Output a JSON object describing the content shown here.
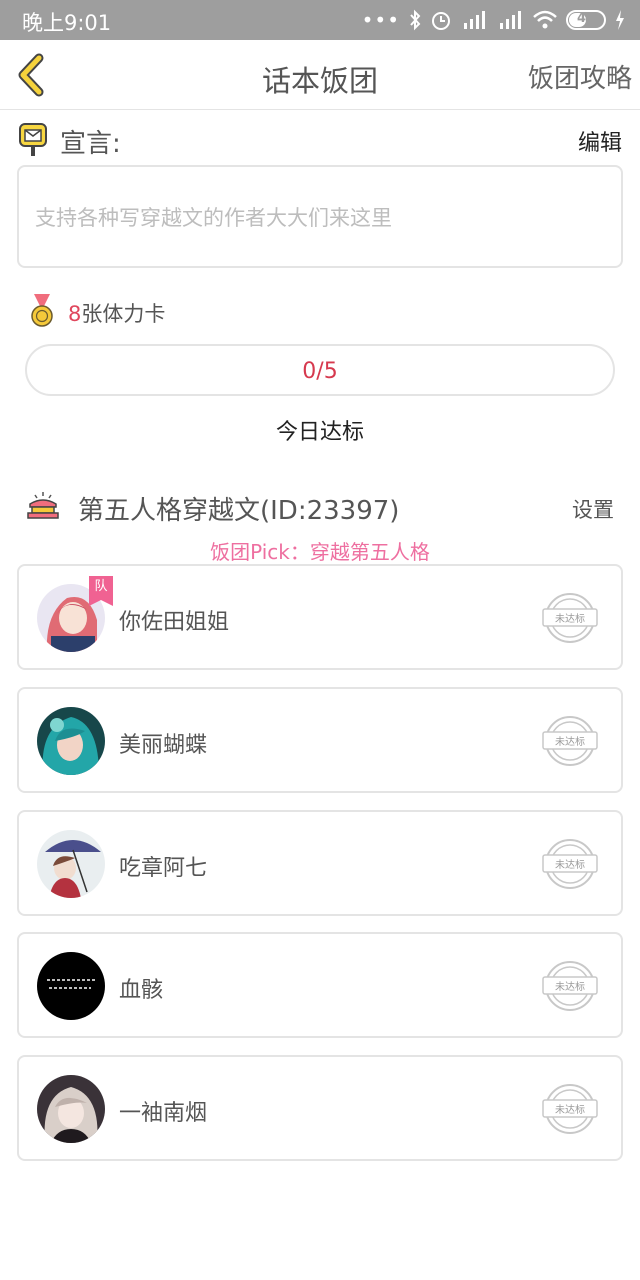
{
  "status_bar": {
    "time": "晚上9:01",
    "dots": "•••",
    "battery": "49"
  },
  "header": {
    "title": "话本饭团",
    "guide_label": "饭团攻略"
  },
  "declaration": {
    "label": "宣言:",
    "edit_label": "编辑",
    "text": "支持各种写穿越文的作者大大们来这里"
  },
  "stamina": {
    "count": "8",
    "unit": "张体力卡",
    "progress_text": "0/5",
    "progress_value": 0,
    "today_label": "今日达标"
  },
  "group": {
    "name": "第五人格穿越文(ID:23397)",
    "settings_label": "设置",
    "pick": "饭团Pick：穿越第五人格"
  },
  "members": [
    {
      "name": "你佐田姐姐",
      "badge": "队",
      "stamp": "未达标",
      "avatar": "avatar-anime-girl-pink-hair"
    },
    {
      "name": "美丽蝴蝶",
      "stamp": "未达标",
      "avatar": "avatar-teal-hair-girl"
    },
    {
      "name": "吃章阿七",
      "stamp": "未达标",
      "avatar": "avatar-girl-with-umbrella"
    },
    {
      "name": "血骸",
      "stamp": "未达标",
      "avatar": "avatar-black-calligraphy"
    },
    {
      "name": "一袖南烟",
      "stamp": "未达标",
      "avatar": "avatar-pale-anime-girl"
    }
  ],
  "colors": {
    "accent_red": "#e0475d",
    "pick_pink": "#ee6fa0",
    "border": "#e4e4e4",
    "back_yellow": "#f5d23c"
  },
  "icons": {
    "back": "chevron-left-icon",
    "mail": "mailbox-icon",
    "medal": "medal-icon",
    "crown": "crown-icon",
    "stamp": "not-reached-stamp-icon"
  }
}
